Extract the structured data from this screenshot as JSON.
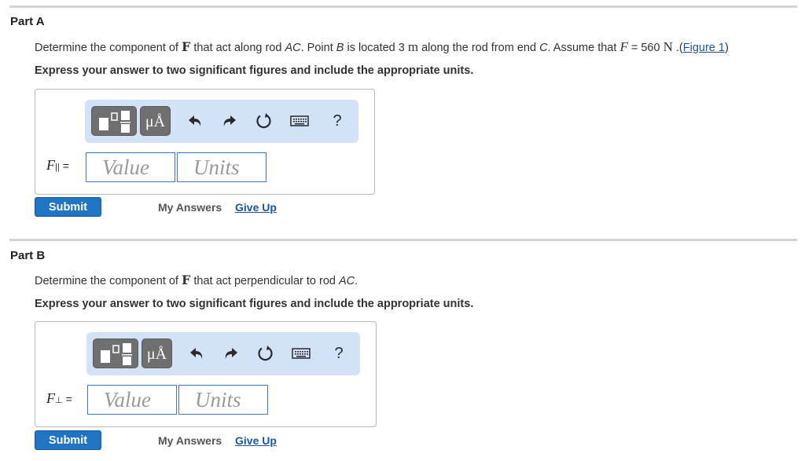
{
  "colors": {
    "accent": "#1f74c4",
    "link": "#1a56a8",
    "toolbar_bg": "#d2e3f8",
    "input_border": "#3f77c6"
  },
  "toolbar_icons": [
    "templates-icon",
    "units-icon",
    "undo-icon",
    "redo-icon",
    "reset-icon",
    "keyboard-icon",
    "help-icon"
  ],
  "parts": [
    {
      "title": "Part A",
      "prompt": {
        "t1": "Determine the component of ",
        "vec": "F",
        "t2": " that act along rod ",
        "rod": "AC",
        "t3": ". Point ",
        "pt": "B",
        "t4": " is located 3 ",
        "unit_m": "m",
        "t5": " along the rod from end ",
        "end": "C",
        "t6": ". Assume that ",
        "fvar": "F",
        "t7": " = 560 ",
        "unit_n": "N",
        "t8": " .(",
        "figure_link": "Figure 1",
        "t9": ")"
      },
      "instruction": "Express your answer to two significant figures and include the appropriate units.",
      "toolbar": {
        "units_label": "μÅ",
        "help_label": "?"
      },
      "variable": {
        "symbol": "F",
        "subscript": "||",
        "equals": "="
      },
      "value_placeholder": "Value",
      "units_placeholder": "Units",
      "submit_label": "Submit",
      "my_answers_label": "My Answers",
      "give_up_label": "Give Up"
    },
    {
      "title": "Part B",
      "prompt": {
        "t1": "Determine the component of ",
        "vec": "F",
        "t2": " that act perpendicular to rod ",
        "rod": "AC",
        "t3": "."
      },
      "instruction": "Express your answer to two significant figures and include the appropriate units.",
      "toolbar": {
        "units_label": "μÅ",
        "help_label": "?"
      },
      "variable": {
        "symbol": "F",
        "subscript": "⊥",
        "equals": "="
      },
      "value_placeholder": "Value",
      "units_placeholder": "Units",
      "submit_label": "Submit",
      "my_answers_label": "My Answers",
      "give_up_label": "Give Up"
    }
  ]
}
